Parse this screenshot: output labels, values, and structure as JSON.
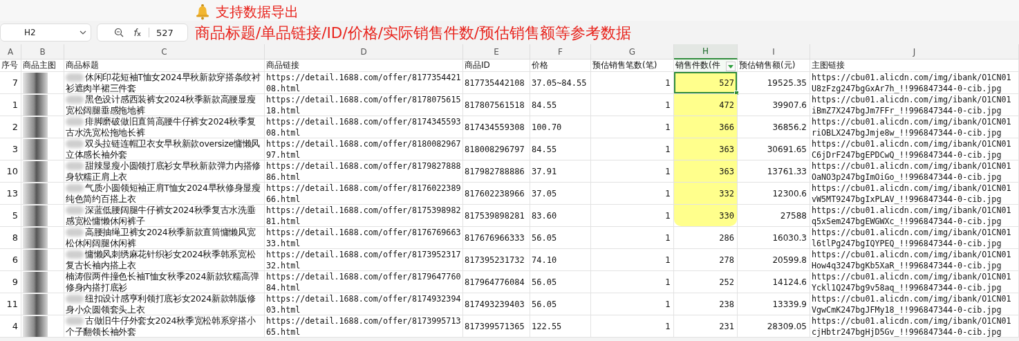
{
  "annotation": {
    "title": "支持数据导出",
    "subtitle": "商品标题/单品链接/ID/价格/实际销售件数/预估销售额等参考数据"
  },
  "formula_bar": {
    "cell": "H2",
    "value": "527"
  },
  "columns": [
    {
      "label": "A",
      "selected": false
    },
    {
      "label": "B",
      "selected": false
    },
    {
      "label": "C",
      "selected": false
    },
    {
      "label": "D",
      "selected": false
    },
    {
      "label": "E",
      "selected": false
    },
    {
      "label": "F",
      "selected": false
    },
    {
      "label": "G",
      "selected": false
    },
    {
      "label": "H",
      "selected": true
    },
    {
      "label": "I",
      "selected": false
    },
    {
      "label": "J",
      "selected": false
    }
  ],
  "header": [
    {
      "text": "序号",
      "filter": false
    },
    {
      "text": "商品主图",
      "filter": false
    },
    {
      "text": "商品标题",
      "filter": false
    },
    {
      "text": "商品链接",
      "filter": false
    },
    {
      "text": "商品ID",
      "filter": false
    },
    {
      "text": "价格",
      "filter": false
    },
    {
      "text": "预估销售笔数(笔)",
      "filter": false
    },
    {
      "text": "销售件数(件",
      "filter": true
    },
    {
      "text": "预估销售额(元)",
      "filter": false
    },
    {
      "text": "主图链接",
      "filter": false
    }
  ],
  "rows": [
    {
      "no": "7",
      "title": "休闲印花短袖T恤女2024早秋新款穿搭条纹衬衫遮肉半裙三件套",
      "title_blurred": true,
      "link": "https://detail.1688.com/offer/817735442108.html",
      "id": "817735442108",
      "price": "37.05~84.55",
      "orders": "1",
      "qty": "527",
      "amount": "19525.35",
      "image_link": "https://cbu01.alicdn.com/img/ibank/O1CN01U8zFzg247bgGxAr7h_!!996847344-0-cib.jpg",
      "highlighted": true,
      "selected": true
    },
    {
      "no": "1",
      "title": "黑色设计感西装裤女2024秋季新款高腰显瘦宽松阔腿垂感拖地裤",
      "title_blurred": true,
      "link": "https://detail.1688.com/offer/817807561518.html",
      "id": "817807561518",
      "price": "84.55",
      "orders": "1",
      "qty": "472",
      "amount": "39907.6",
      "image_link": "https://cbu01.alicdn.com/img/ibank/O1CN01iBmZ7X247bgJm7FFr_!!996847344-0-cib.jpg",
      "highlighted": true,
      "selected": false
    },
    {
      "no": "2",
      "title": "痱脚磨破做旧直筒高腰牛仔裤女2024秋季复古水洗宽松拖地长裤",
      "title_blurred": true,
      "link": "https://detail.1688.com/offer/817434559308.html",
      "id": "817434559308",
      "price": "100.70",
      "orders": "1",
      "qty": "366",
      "amount": "36856.2",
      "image_link": "https://cbu01.alicdn.com/img/ibank/O1CN01riOBLX247bgJmje8w_!!996847344-0-cib.jpg",
      "highlighted": true,
      "selected": false
    },
    {
      "no": "3",
      "title": "双头拉链连帽卫衣女早秋新款oversize慵懒风立体感长袖外套",
      "title_blurred": true,
      "link": "https://detail.1688.com/offer/818008296797.html",
      "id": "818008296797",
      "price": "84.55",
      "orders": "1",
      "qty": "363",
      "amount": "30691.65",
      "image_link": "https://cbu01.alicdn.com/img/ibank/O1CN01C6jDrF247bgEPDCwQ_!!996847344-0-cib.jpg",
      "highlighted": true,
      "selected": false
    },
    {
      "no": "10",
      "title": "甜辣显瘦小圆领打底衫女早秋新款弹力内搭修身软糯正肩上衣",
      "title_blurred": true,
      "link": "https://detail.1688.com/offer/817982788886.html",
      "id": "817982788886",
      "price": "37.91",
      "orders": "1",
      "qty": "363",
      "amount": "13761.33",
      "image_link": "https://cbu01.alicdn.com/img/ibank/O1CN01OaNO3p247bgImOiGo_!!996847344-0-cib.jpg",
      "highlighted": true,
      "selected": false
    },
    {
      "no": "13",
      "title": "气质小圆领短袖正肩T恤女2024早秋修身显瘦纯色简约百搭上衣",
      "title_blurred": true,
      "link": "https://detail.1688.com/offer/817602238966.html",
      "id": "817602238966",
      "price": "37.05",
      "orders": "1",
      "qty": "332",
      "amount": "12300.6",
      "image_link": "https://cbu01.alicdn.com/img/ibank/O1CN01vW5MT9247bgIxPLAV_!!996847344-0-cib.jpg",
      "highlighted": true,
      "selected": false
    },
    {
      "no": "5",
      "title": "深蓝低腰阔腿牛仔裤女2024秋季复古水洗垂感宽松慵懒休闲裤子",
      "title_blurred": true,
      "link": "https://detail.1688.com/offer/817539898281.html",
      "id": "817539898281",
      "price": "83.60",
      "orders": "1",
      "qty": "330",
      "amount": "27588",
      "image_link": "https://cbu01.alicdn.com/img/ibank/O1CN01q5xSem247bgEWGWXc_!!996847344-0-cib.jpg",
      "highlighted": true,
      "selected": false
    },
    {
      "no": "8",
      "title": "高腰抽绳卫裤女2024秋季新款直筒慵懒风宽松休闲阔腿休闲裤",
      "title_blurred": true,
      "link": "https://detail.1688.com/offer/817676966333.html",
      "id": "817676966333",
      "price": "56.05",
      "orders": "1",
      "qty": "286",
      "amount": "16030.3",
      "image_link": "https://cbu01.alicdn.com/img/ibank/O1CN01l6tlPg247bgIQYPEQ_!!996847344-0-cib.jpg",
      "highlighted": false,
      "selected": false
    },
    {
      "no": "6",
      "title": "慵懒风刺绣麻花针织衫女2024秋季韩系宽松复古长袖内搭上衣",
      "title_blurred": true,
      "link": "https://detail.1688.com/offer/817395231732.html",
      "id": "817395231732",
      "price": "74.10",
      "orders": "1",
      "qty": "278",
      "amount": "20599.8",
      "image_link": "https://cbu01.alicdn.com/img/ibank/O1CN01How4q3247bgKb5XaR_!!996847344-0-cib.jpg",
      "highlighted": false,
      "selected": false
    },
    {
      "no": "9",
      "title": "楠涛假两件撞色长袖T恤女秋季2024新款软糯高弹修身内搭打底衫",
      "title_blurred": false,
      "link": "https://detail.1688.com/offer/817964776084.html",
      "id": "817964776084",
      "price": "56.05",
      "orders": "1",
      "qty": "252",
      "amount": "14124.6",
      "image_link": "https://cbu01.alicdn.com/img/ibank/O1CN01Yckl1Q247bg9v58aq_!!996847344-0-cib.jpg",
      "highlighted": false,
      "selected": false
    },
    {
      "no": "11",
      "title": "纽扣设计感亨利领打底衫女2024新款韩版修身小众圆领套头上衣",
      "title_blurred": true,
      "link": "https://detail.1688.com/offer/817493239403.html",
      "id": "817493239403",
      "price": "56.05",
      "orders": "1",
      "qty": "238",
      "amount": "13339.9",
      "image_link": "https://cbu01.alicdn.com/img/ibank/O1CN01VgwCmK247bgJFMy18_!!996847344-0-cib.jpg",
      "highlighted": false,
      "selected": false
    },
    {
      "no": "4",
      "title": "古做旧牛仔外套女2024秋季宽松韩系穿搭小个子翻领长袖外套",
      "title_blurred": true,
      "link": "https://detail.1688.com/offer/817399571365.html",
      "id": "817399571365",
      "price": "122.55",
      "orders": "1",
      "qty": "231",
      "amount": "28309.05",
      "image_link": "https://cbu01.alicdn.com/img/ibank/O1CN01cjHbtr247bgHjD5Gv_!!996847344-0-cib.jpg",
      "highlighted": false,
      "selected": false
    }
  ]
}
